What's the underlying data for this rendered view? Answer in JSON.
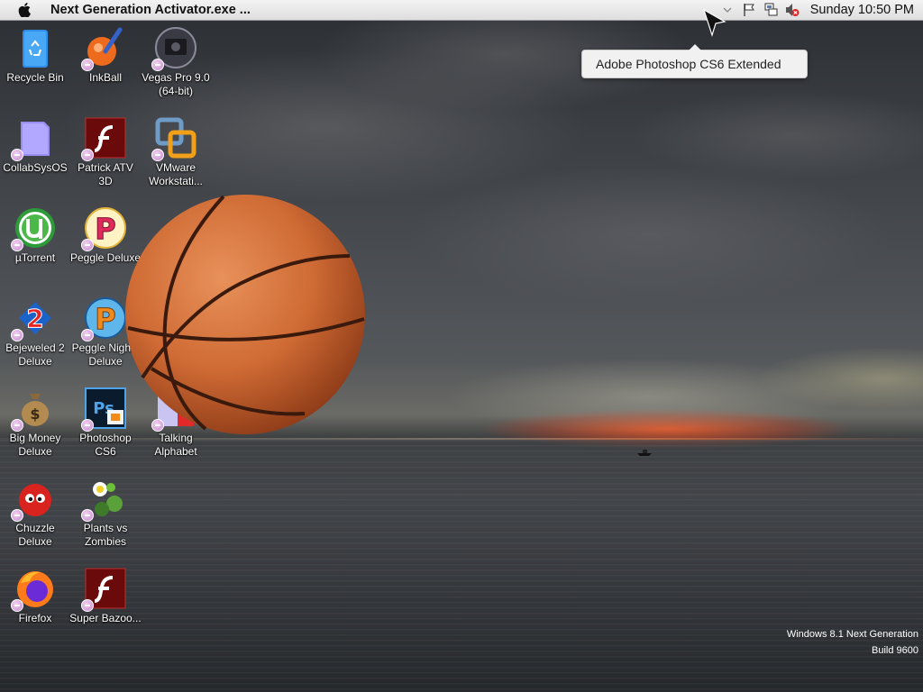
{
  "menubar": {
    "app_title": "Next Generation Activator.exe ...",
    "clock": "Sunday 10:50 PM",
    "icons": [
      "apple-icon",
      "chevron-down-icon",
      "flag-icon",
      "network-icon",
      "speaker-muted-icon"
    ]
  },
  "tooltip": {
    "text": "Adobe Photoshop CS6 Extended"
  },
  "desktop": {
    "icons": [
      {
        "label": "Recycle Bin",
        "icon": "recycle-bin-icon"
      },
      {
        "label": "InkBall",
        "icon": "inkball-icon"
      },
      {
        "label": "Vegas Pro 9.0 (64-bit)",
        "icon": "vegas-pro-icon"
      },
      {
        "label": "CollabSysOS",
        "icon": "folder-icon"
      },
      {
        "label": "Patrick ATV 3D",
        "icon": "flash-icon"
      },
      {
        "label": "VMware Workstati...",
        "icon": "vmware-icon"
      },
      {
        "label": "µTorrent",
        "icon": "utorrent-icon"
      },
      {
        "label": "Peggle Deluxe",
        "icon": "peggle-icon"
      },
      {
        "label": "Bejeweled 2 Deluxe",
        "icon": "bejeweled-icon"
      },
      {
        "label": "Peggle Nights Deluxe",
        "icon": "peggle-nights-icon"
      },
      {
        "label": "Big Money Deluxe",
        "icon": "money-bag-icon"
      },
      {
        "label": "Photoshop CS6",
        "icon": "photoshop-icon"
      },
      {
        "label": "Talking Alphabet",
        "icon": "talking-alphabet-icon"
      },
      {
        "label": "Chuzzle Deluxe",
        "icon": "chuzzle-icon"
      },
      {
        "label": "Plants vs Zombies",
        "icon": "plants-vs-zombies-icon"
      },
      {
        "label": "Firefox",
        "icon": "firefox-icon"
      },
      {
        "label": "Super Bazoo...",
        "icon": "flash-icon"
      }
    ]
  },
  "watermark": {
    "line1": "Windows 8.1 Next Generation",
    "line2": "Build 9600"
  },
  "colors": {
    "menubar": "#e8e8e8",
    "badge": "#c68bd0",
    "sunset": "#f05a28"
  }
}
